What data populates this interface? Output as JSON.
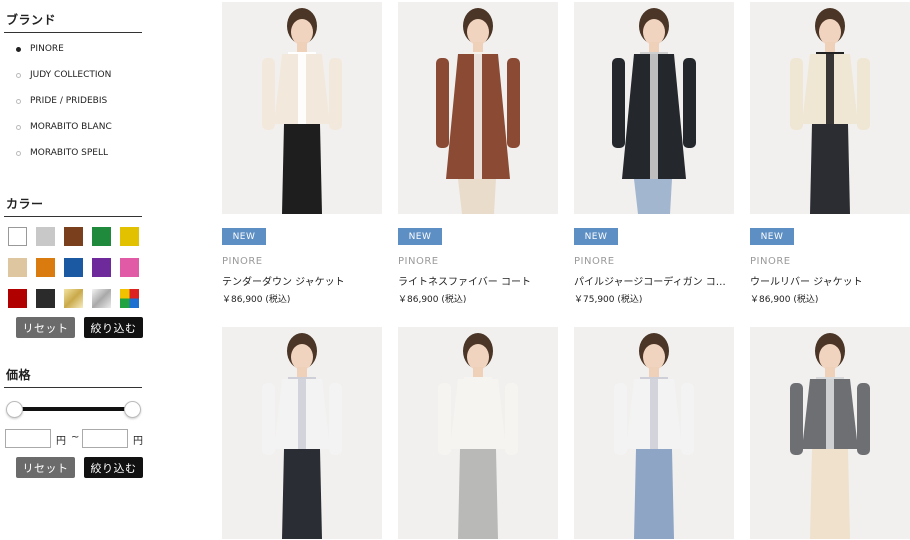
{
  "filters": {
    "brand": {
      "title": "ブランド",
      "items": [
        {
          "label": "PINORE",
          "active": true
        },
        {
          "label": "JUDY COLLECTION",
          "active": false
        },
        {
          "label": "PRIDE / PRIDEBIS",
          "active": false
        },
        {
          "label": "MORABITO BLANC",
          "active": false
        },
        {
          "label": "MORABITO SPELL",
          "active": false
        }
      ]
    },
    "color": {
      "title": "カラー",
      "swatches": [
        [
          "#ffffff",
          "#c8c8c8",
          "#7a3f1d",
          "#1f8a3c",
          "#e2c200"
        ],
        [
          "#ddc6a0",
          "#d97b0f",
          "#1b5aa3",
          "#6e2a9a",
          "#e05aa6"
        ],
        [
          "#b00000",
          "#2b2b2b",
          "gold",
          "silver",
          "multi"
        ]
      ],
      "reset_label": "リセット",
      "apply_label": "絞り込む"
    },
    "price": {
      "title": "価格",
      "min_value": "",
      "max_value": "",
      "unit": "円",
      "separator": "~",
      "reset_label": "リセット",
      "apply_label": "絞り込む"
    }
  },
  "products": [
    {
      "brand": "PINORE",
      "name": "テンダーダウン ジャケット",
      "price": "￥86,900",
      "tax": "(税込)",
      "badge": "NEW",
      "top": "#f2e9dc",
      "bottom": "#1e1e1e",
      "inner": "#ffffff"
    },
    {
      "brand": "PINORE",
      "name": "ライトネスファイバー コート",
      "price": "￥86,900",
      "tax": "(税込)",
      "badge": "NEW",
      "top": "#8a4a33",
      "bottom": "#e9dccb",
      "inner": "#f5f2ec"
    },
    {
      "brand": "PINORE",
      "name": "パイルジャージコーディガン コー…",
      "price": "￥75,900",
      "tax": "(税込)",
      "badge": "NEW",
      "top": "#24272b",
      "bottom": "#a3b6cf",
      "inner": "#cfcfcf"
    },
    {
      "brand": "PINORE",
      "name": "ウールリバー ジャケット",
      "price": "￥86,900",
      "tax": "(税込)",
      "badge": "NEW",
      "top": "#efe6d4",
      "bottom": "#2b2d33",
      "inner": "#222222"
    },
    {
      "top": "#f3f3f3",
      "bottom": "#2a2d33",
      "inner": "#cfcfd8"
    },
    {
      "top": "#f5f4f1",
      "bottom": "#b9bab8",
      "inner": "#f5f4f1"
    },
    {
      "top": "#f3f3f3",
      "bottom": "#8fa5c6",
      "inner": "#cfcfd8"
    },
    {
      "top": "#6d6f73",
      "bottom": "#efe1cc",
      "inner": "#d9dadc"
    }
  ]
}
